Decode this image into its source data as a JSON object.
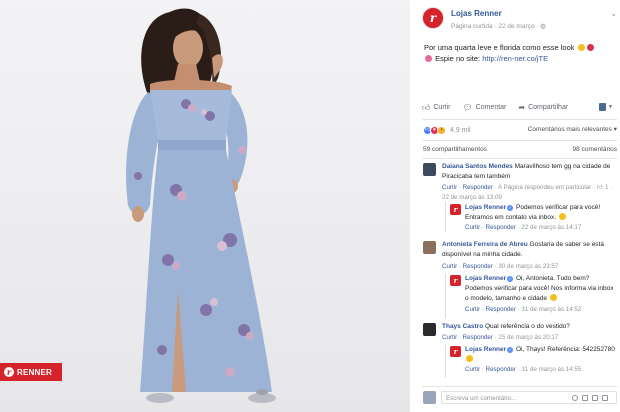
{
  "photo": {
    "badge_brand": "RENNER",
    "badge_logo": "r"
  },
  "post": {
    "page_name": "Lojas Renner",
    "avatar_letter": "r",
    "meta_prefix": "Página curtida",
    "meta_date": "22 de março",
    "text_line1": "Por uma quarta leve e florida como esse look",
    "text_line2_prefix": "Espie no site:",
    "link": "http://ren-ner.co/jTE"
  },
  "actions": {
    "like": "Curtir",
    "comment": "Comentar",
    "share": "Compartilhar"
  },
  "reactions": {
    "count": "4,9 mil",
    "relevance": "Comentários mais relevantes"
  },
  "stats": {
    "shares": "59 compartilhamentos",
    "comments": "98 comentários"
  },
  "comments": [
    {
      "name": "Daiana Santos Mendes",
      "text": "Maravilhoso tem gg na cidade de Piracicaba tem também",
      "like": "Curtir",
      "reply": "Responder",
      "extra": "A Página respondeu em particular",
      "count": "1",
      "time": "22 de março às 13:09",
      "reply_item": {
        "name": "Lojas Renner",
        "text": "Podemos verificar para você! Entramos em contato via inbox.",
        "like": "Curtir",
        "reply": "Responder",
        "time": "22 de março às 14:17"
      }
    },
    {
      "name": "Antonieta Ferreira de Abreu",
      "text": "Gostaria de saber se está disponível na minha cidade.",
      "like": "Curtir",
      "reply": "Responder",
      "time": "30 de março às 23:57",
      "reply_item": {
        "name": "Lojas Renner",
        "text": "Oi, Antonieta. Tudo bem? Podemos verificar para você! Nos informa via inbox o modelo, tamanho e cidade",
        "like": "Curtir",
        "reply": "Responder",
        "time": "31 de março às 14:52"
      }
    },
    {
      "name": "Thays Castro",
      "text": "Qual referência o do vestido?",
      "like": "Curtir",
      "reply": "Responder",
      "time": "25 de março às 20:17",
      "reply_item": {
        "name": "Lojas Renner",
        "text": "Oi, Thays! Referência: 542252780",
        "like": "Curtir",
        "reply": "Responder",
        "time": "31 de março às 14:55"
      }
    }
  ],
  "compose": {
    "placeholder": "Escreva um comentário..."
  },
  "colors": {
    "brand_red": "#d5222b",
    "link_blue": "#365899",
    "dress_blue": "#9db3d6"
  }
}
